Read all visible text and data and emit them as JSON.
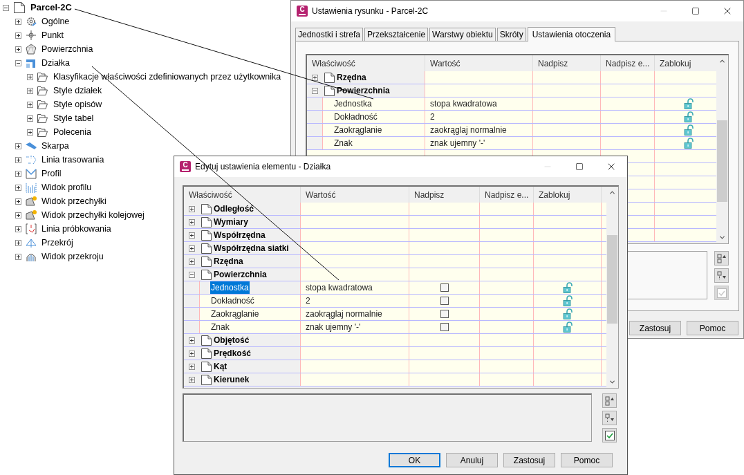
{
  "tree": {
    "label": "Parcel-2C",
    "expanded": true,
    "children": [
      {
        "label": "Ogólne",
        "expanded": false
      },
      {
        "label": "Punkt",
        "expanded": false
      },
      {
        "label": "Powierzchnia",
        "expanded": false
      },
      {
        "label": "Działka",
        "expanded": true,
        "children": [
          {
            "label": "Klasyfikacje właściwości zdefiniowanych przez użytkownika",
            "expanded": false
          },
          {
            "label": "Style działek",
            "expanded": false
          },
          {
            "label": "Style opisów",
            "expanded": false
          },
          {
            "label": "Style tabel",
            "expanded": false
          },
          {
            "label": "Polecenia",
            "expanded": false
          }
        ]
      },
      {
        "label": "Skarpa",
        "expanded": false
      },
      {
        "label": "Linia trasowania",
        "expanded": false
      },
      {
        "label": "Profil",
        "expanded": false
      },
      {
        "label": "Widok profilu",
        "expanded": false
      },
      {
        "label": "Widok przechyłki",
        "expanded": false
      },
      {
        "label": "Widok przechyłki kolejowej",
        "expanded": false
      },
      {
        "label": "Linia próbkowania",
        "expanded": false
      },
      {
        "label": "Przekrój",
        "expanded": false
      },
      {
        "label": "Widok przekroju",
        "expanded": false
      }
    ]
  },
  "drawing_settings": {
    "logo": "C",
    "title": "Ustawienia rysunku - Parcel-2C",
    "tabs": [
      {
        "label": "Jednostki i strefa",
        "selected": false
      },
      {
        "label": "Przekształcenie",
        "selected": false
      },
      {
        "label": "Warstwy obiektu",
        "selected": false
      },
      {
        "label": "Skróty",
        "selected": false
      },
      {
        "label": "Ustawienia otoczenia",
        "selected": true
      }
    ],
    "columns": [
      "Właściwość",
      "Wartość",
      "Nadpisz",
      "Nadpisz e...",
      "Zablokuj"
    ],
    "rows": [
      {
        "kind": "group",
        "label": "Rzędna",
        "expanded": false
      },
      {
        "kind": "group",
        "label": "Powierzchnia",
        "expanded": true
      },
      {
        "kind": "property",
        "label": "Jednostka",
        "value": "stopa kwadratowa",
        "locked": false,
        "selected": false
      },
      {
        "kind": "property",
        "label": "Dokładność",
        "value": "2",
        "locked": false,
        "selected": false
      },
      {
        "kind": "property",
        "label": "Zaokrąglanie",
        "value": "zaokrąglaj normalnie",
        "locked": false,
        "selected": false
      },
      {
        "kind": "property",
        "label": "Znak",
        "value": "znak ujemny '-'",
        "locked": false,
        "selected": false
      }
    ],
    "tools": [
      {
        "kind": "collapse",
        "disabled": false
      },
      {
        "kind": "expand",
        "disabled": false
      },
      {
        "kind": "check",
        "disabled": true
      }
    ],
    "buttons": [
      {
        "label": "Zastosuj",
        "default": false
      },
      {
        "label": "Pomoc",
        "default": false
      }
    ]
  },
  "element_settings": {
    "logo": "C",
    "title": "Edytuj ustawienia elementu - Działka",
    "columns": [
      "Właściwość",
      "Wartość",
      "Nadpisz",
      "Nadpisz e...",
      "Zablokuj"
    ],
    "rows": [
      {
        "kind": "group",
        "label": "Odległość",
        "expanded": false
      },
      {
        "kind": "group",
        "label": "Wymiary",
        "expanded": false
      },
      {
        "kind": "group",
        "label": "Współrzędna",
        "expanded": false
      },
      {
        "kind": "group",
        "label": "Współrzędna siatki",
        "expanded": false
      },
      {
        "kind": "group",
        "label": "Rzędna",
        "expanded": false
      },
      {
        "kind": "group",
        "label": "Powierzchnia",
        "expanded": true
      },
      {
        "kind": "property",
        "label": "Jednostka",
        "value": "stopa kwadratowa",
        "override": false,
        "locked": false,
        "selected": true
      },
      {
        "kind": "property",
        "label": "Dokładność",
        "value": "2",
        "override": false,
        "locked": false,
        "selected": false
      },
      {
        "kind": "property",
        "label": "Zaokrąglanie",
        "value": "zaokrąglaj normalnie",
        "override": false,
        "locked": false,
        "selected": false
      },
      {
        "kind": "property",
        "label": "Znak",
        "value": "znak ujemny '-'",
        "override": false,
        "locked": false,
        "selected": false
      },
      {
        "kind": "group",
        "label": "Objętość",
        "expanded": false
      },
      {
        "kind": "group",
        "label": "Prędkość",
        "expanded": false
      },
      {
        "kind": "group",
        "label": "Kąt",
        "expanded": false
      },
      {
        "kind": "group",
        "label": "Kierunek",
        "expanded": false
      }
    ],
    "tools": [
      {
        "kind": "collapse",
        "disabled": false
      },
      {
        "kind": "expand",
        "disabled": false
      },
      {
        "kind": "check",
        "disabled": false
      }
    ],
    "buttons": [
      {
        "label": "OK",
        "default": true
      },
      {
        "label": "Anuluj",
        "default": false
      },
      {
        "label": "Zastosuj",
        "default": false
      },
      {
        "label": "Pomoc",
        "default": false
      }
    ]
  }
}
